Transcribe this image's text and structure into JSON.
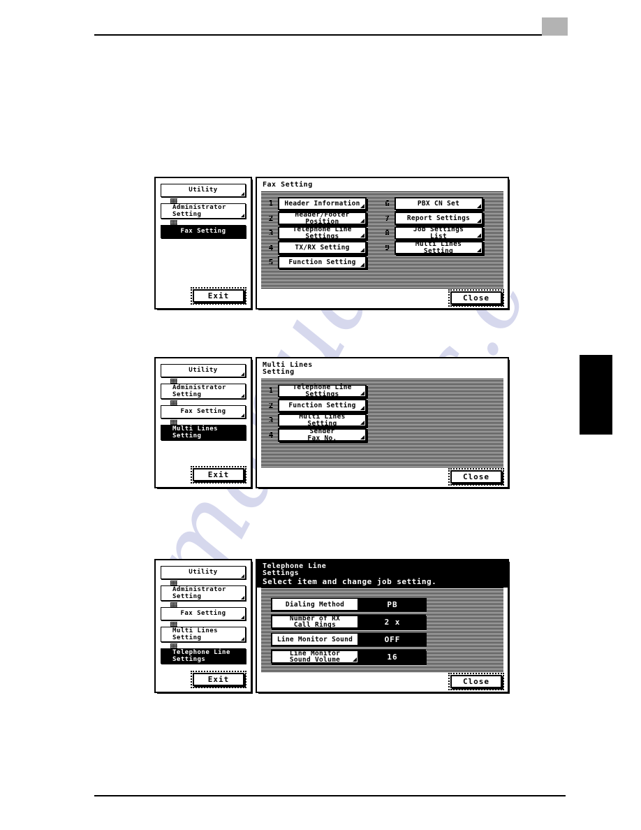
{
  "page": {
    "header_accent_color": "#b3b3b3",
    "rule_color": "#000000",
    "watermark_text_1": "manuals",
    "watermark_text_2": "c.c"
  },
  "panels": [
    {
      "id": "fax-setting",
      "sidebar": {
        "items": [
          {
            "label": "Utility",
            "lines": [
              "Utility"
            ],
            "selected": false,
            "has_fold": true
          },
          {
            "label": "Administrator Setting",
            "lines": [
              "Administrator",
              "Setting"
            ],
            "selected": false,
            "has_fold": true
          },
          {
            "label": "Fax Setting",
            "lines": [
              "Fax Setting"
            ],
            "selected": true,
            "has_fold": false
          }
        ],
        "exit_label": "Exit"
      },
      "title": "Fax Setting",
      "subtitle": "",
      "inverted_title": false,
      "menu": [
        {
          "num": "1",
          "lines": [
            "Header Information"
          ]
        },
        {
          "num": "6",
          "lines": [
            "PBX CN Set"
          ]
        },
        {
          "num": "2",
          "lines": [
            "Header/Footer",
            "Position"
          ]
        },
        {
          "num": "7",
          "lines": [
            "Report Settings"
          ]
        },
        {
          "num": "3",
          "lines": [
            "Telephone Line",
            "Settings"
          ]
        },
        {
          "num": "8",
          "lines": [
            "Job Settings",
            "List"
          ]
        },
        {
          "num": "4",
          "lines": [
            "TX/RX Setting"
          ]
        },
        {
          "num": "9",
          "lines": [
            "Multi Lines",
            "Setting"
          ]
        },
        {
          "num": "5",
          "lines": [
            "Function Setting"
          ]
        }
      ],
      "close_label": "Close"
    },
    {
      "id": "multi-lines-setting",
      "sidebar": {
        "items": [
          {
            "label": "Utility",
            "lines": [
              "Utility"
            ],
            "selected": false,
            "has_fold": true
          },
          {
            "label": "Administrator Setting",
            "lines": [
              "Administrator",
              "Setting"
            ],
            "selected": false,
            "has_fold": true
          },
          {
            "label": "Fax Setting",
            "lines": [
              "Fax Setting"
            ],
            "selected": false,
            "has_fold": true
          },
          {
            "label": "Multi Lines Setting",
            "lines": [
              "Multi Lines",
              "Setting"
            ],
            "selected": true,
            "has_fold": false
          }
        ],
        "exit_label": "Exit"
      },
      "title": "Multi Lines\nSetting",
      "subtitle": "",
      "inverted_title": false,
      "menu": [
        {
          "num": "1",
          "lines": [
            "Telephone Line",
            "Settings"
          ]
        },
        {
          "num": "2",
          "lines": [
            "Function Setting"
          ]
        },
        {
          "num": "3",
          "lines": [
            "Multi Lines",
            "Setting"
          ]
        },
        {
          "num": "4",
          "lines": [
            "Sender",
            "Fax No."
          ]
        }
      ],
      "close_label": "Close"
    },
    {
      "id": "telephone-line-settings",
      "sidebar": {
        "items": [
          {
            "label": "Utility",
            "lines": [
              "Utility"
            ],
            "selected": false,
            "has_fold": true
          },
          {
            "label": "Administrator Setting",
            "lines": [
              "Administrator",
              "Setting"
            ],
            "selected": false,
            "has_fold": true
          },
          {
            "label": "Fax Setting",
            "lines": [
              "Fax Setting"
            ],
            "selected": false,
            "has_fold": true
          },
          {
            "label": "Multi Lines Setting",
            "lines": [
              "Multi Lines",
              "Setting"
            ],
            "selected": false,
            "has_fold": true
          },
          {
            "label": "Telephone Line Settings",
            "lines": [
              "Telephone Line",
              "Settings"
            ],
            "selected": true,
            "has_fold": false
          }
        ],
        "exit_label": "Exit"
      },
      "title": "Telephone Line\nSettings",
      "subtitle": "Select item and change job setting.",
      "inverted_title": true,
      "settings": [
        {
          "lines": [
            "Dialing Method"
          ],
          "value": "PB",
          "has_fold": false
        },
        {
          "lines": [
            "Number of RX",
            "Call Rings"
          ],
          "value": "2 x",
          "has_fold": false
        },
        {
          "lines": [
            "Line Monitor Sound"
          ],
          "value": "OFF",
          "has_fold": false
        },
        {
          "lines": [
            "Line Monitor",
            "Sound Volume"
          ],
          "value": "16",
          "has_fold": true
        }
      ],
      "close_label": "Close"
    }
  ]
}
